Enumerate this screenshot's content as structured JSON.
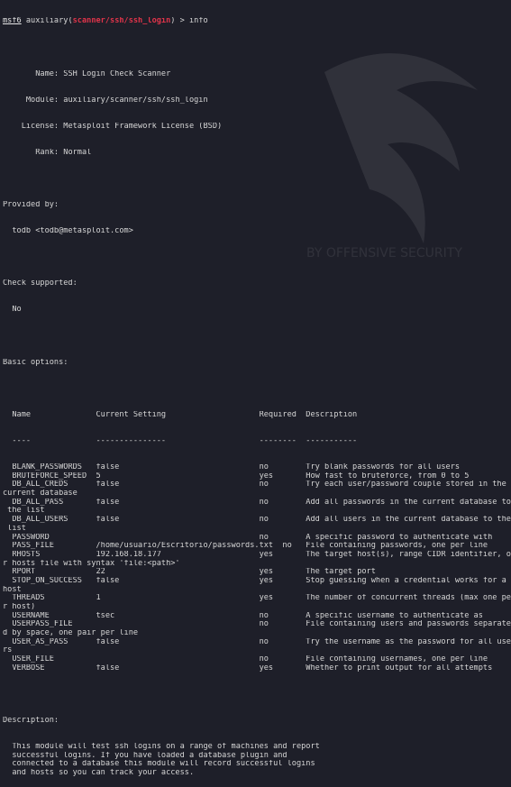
{
  "prompt": {
    "prefix": "msf6",
    "module_type": " auxiliary(",
    "module_path": "scanner/ssh/ssh_login",
    "suffix": ") > ",
    "command": "info"
  },
  "module_info": [
    {
      "key": "       Name:",
      "value": " SSH Login Check Scanner"
    },
    {
      "key": "     Module:",
      "value": " auxiliary/scanner/ssh/ssh_login"
    },
    {
      "key": "    License:",
      "value": " Metasploit Framework License (BSD)"
    },
    {
      "key": "       Rank:",
      "value": " Normal"
    }
  ],
  "provided_by": {
    "heading": "Provided by:",
    "author": "  todb <todb@metasploit.com>"
  },
  "check_supported": {
    "heading": "Check supported:",
    "value": "  No"
  },
  "basic_options": {
    "heading": "Basic options:",
    "header_line": "  Name              Current Setting                    Required  Description",
    "underline_line": "  ----              ---------------                    --------  -----------",
    "lines": [
      "  BLANK_PASSWORDS   false                              no        Try blank passwords for all users",
      "  BRUTEFORCE_SPEED  5                                  yes       How fast to bruteforce, from 0 to 5",
      "  DB_ALL_CREDS      false                              no        Try each user/password couple stored in the",
      "current database",
      "  DB_ALL_PASS       false                              no        Add all passwords in the current database to",
      " the list",
      "  DB_ALL_USERS      false                              no        Add all users in the current database to the",
      " list",
      "  PASSWORD                                             no        A specific password to authenticate with",
      "  PASS_FILE         /home/usuario/Escritorio/passwords.txt  no   File containing passwords, one per line",
      "  RHOSTS            192.168.18.177                     yes       The target host(s), range CIDR identifier, o",
      "r hosts file with syntax 'file:<path>'",
      "  RPORT             22                                 yes       The target port",
      "  STOP_ON_SUCCESS   false                              yes       Stop guessing when a credential works for a",
      "host",
      "  THREADS           1                                  yes       The number of concurrent threads (max one pe",
      "r host)",
      "  USERNAME          tsec                               no        A specific username to authenticate as",
      "  USERPASS_FILE                                        no        File containing users and passwords separate",
      "d by space, one pair per line",
      "  USER_AS_PASS      false                              no        Try the username as the password for all use",
      "rs",
      "  USER_FILE                                            no        File containing usernames, one per line",
      "  VERBOSE           false                              yes       Whether to print output for all attempts"
    ]
  },
  "description": {
    "heading": "Description:",
    "lines": [
      "  This module will test ssh logins on a range of machines and report",
      "  successful logins. If you have loaded a database plugin and",
      "  connected to a database this module will record successful logins",
      "  and hosts so you can track your access."
    ]
  },
  "watermark_text": "BY OFFENSIVE SECURITY",
  "colors": {
    "background": "#1e1f29",
    "text": "#d6d6d6",
    "module_red": "#e0344a"
  }
}
